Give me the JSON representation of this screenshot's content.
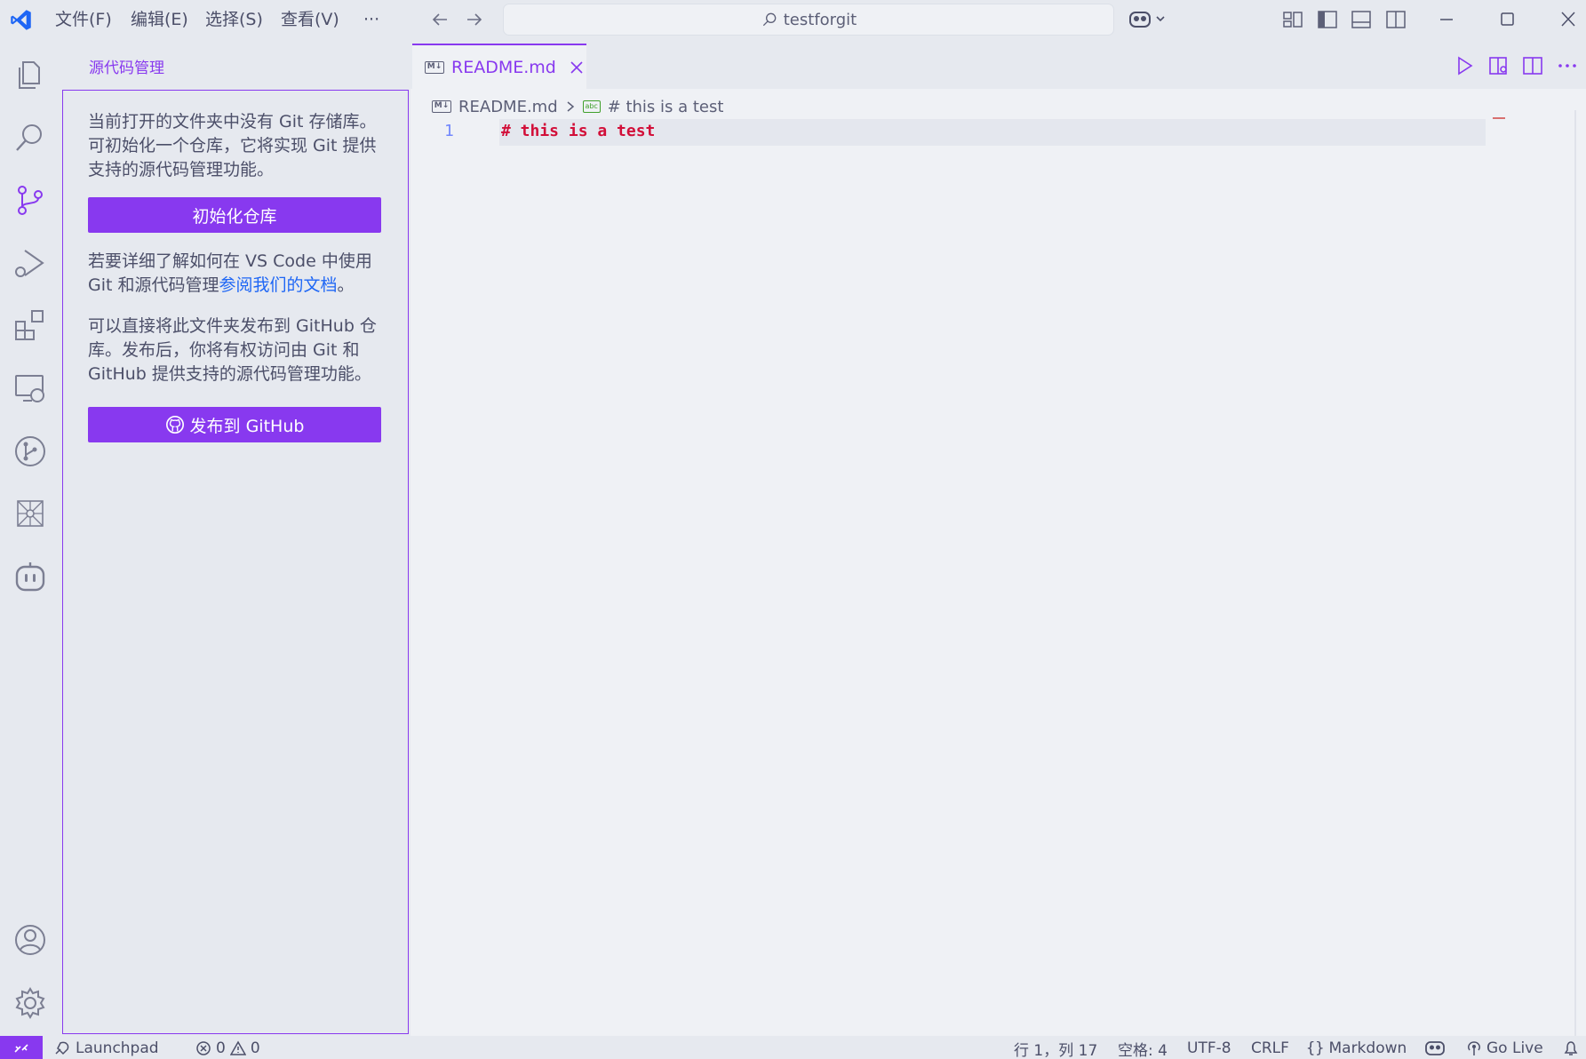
{
  "titlebar": {
    "menus": [
      "文件(F)",
      "编辑(E)",
      "选择(S)",
      "查看(V)",
      "···"
    ],
    "search_text": "testforgit"
  },
  "sidebar": {
    "title": "源代码管理",
    "no_repo_text": "当前打开的文件夹中没有 Git 存储库。可初始化一个仓库，它将实现 Git 提供支持的源代码管理功能。",
    "init_button": "初始化仓库",
    "learn_more_prefix": "若要详细了解如何在 VS Code 中使用 Git 和源代码管理",
    "learn_more_link": "参阅我们的文档",
    "learn_more_suffix": "。",
    "publish_text": "可以直接将此文件夹发布到 GitHub 仓库。发布后，你将有权访问由 Git 和 GitHub 提供支持的源代码管理功能。",
    "publish_button": "发布到 GitHub"
  },
  "editor": {
    "tab_label": "README.md",
    "tab_badge": "M↓",
    "breadcrumb": {
      "file": "README.md",
      "symbol_badge": "abc",
      "symbol": "# this is a test"
    },
    "lines": [
      {
        "number": "1",
        "text": "# this is a test"
      }
    ]
  },
  "statusbar": {
    "launchpad": "Launchpad",
    "errors": "0",
    "warnings": "0",
    "position": "行 1，列 17",
    "spaces": "空格: 4",
    "encoding": "UTF-8",
    "eol": "CRLF",
    "language": "Markdown",
    "golive": "Go Live"
  },
  "colors": {
    "accent": "#8839ef",
    "link": "#1e66f5",
    "heading_red": "#d20f39"
  }
}
